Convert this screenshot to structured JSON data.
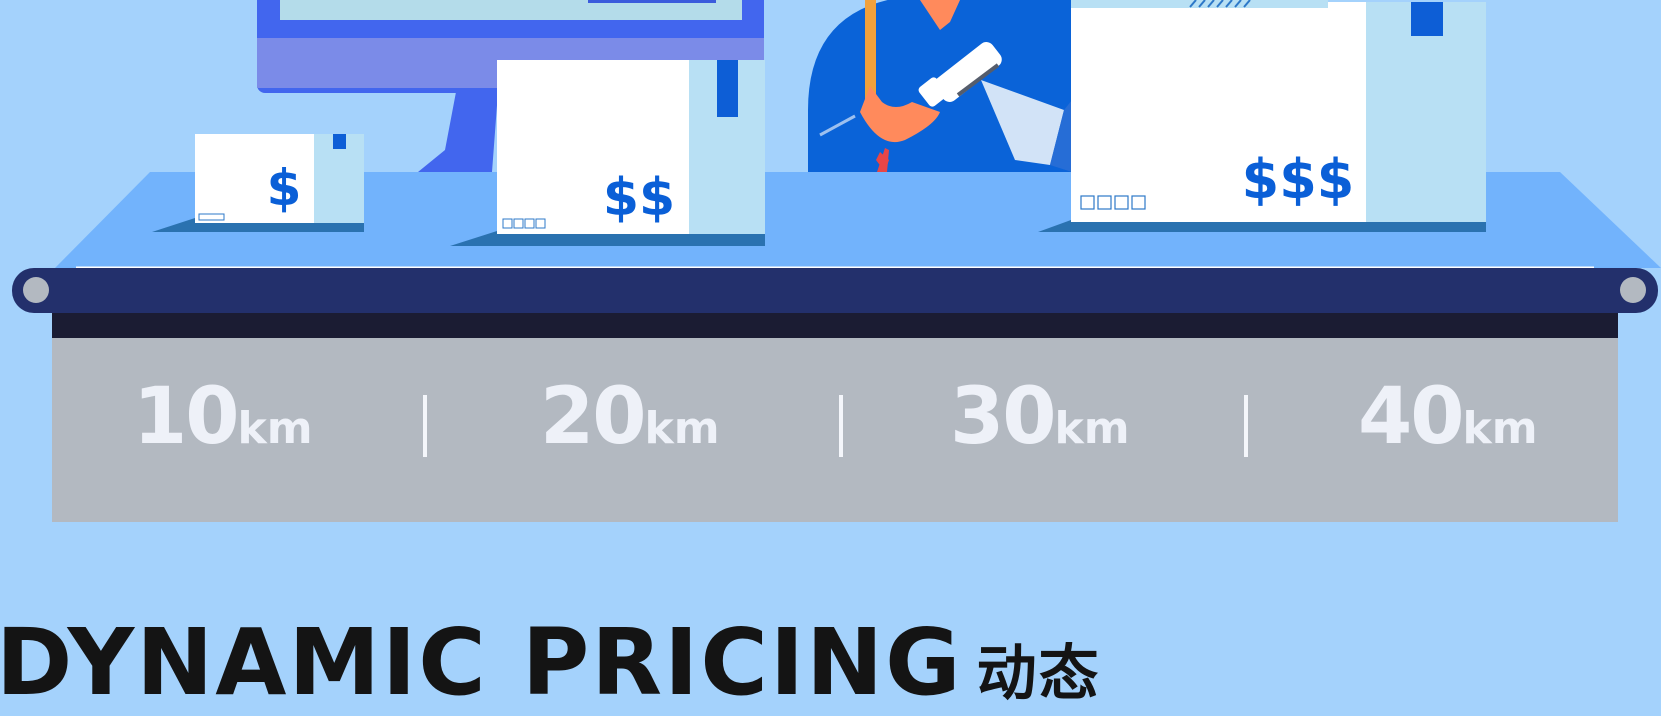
{
  "price_tags": {
    "small": "$",
    "medium": "$$",
    "large": "$$$"
  },
  "distance_scale": [
    {
      "value": "10",
      "unit": "km"
    },
    {
      "value": "20",
      "unit": "km"
    },
    {
      "value": "30",
      "unit": "km"
    },
    {
      "value": "40",
      "unit": "km"
    }
  ],
  "title": {
    "main": "DYNAMIC PRICING",
    "cjk": "动态"
  },
  "icons": [
    "monitor-icon",
    "courier-figure",
    "barcode-scanner-icon",
    "parcel-box-icon",
    "conveyor-belt"
  ],
  "colors": {
    "background": "#a4d2fc",
    "price_blue": "#0a5fd7",
    "belt_navy": "#23306c",
    "scale_gray": "#b3b9c1"
  }
}
